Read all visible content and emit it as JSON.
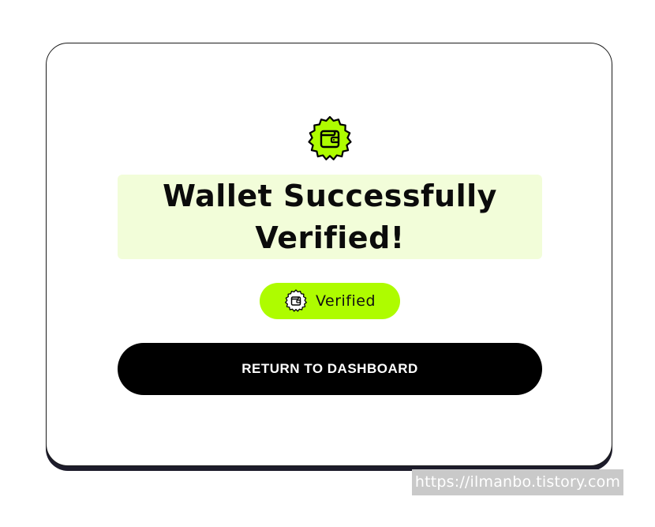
{
  "card": {
    "title": "Wallet Successfully Verified!",
    "status_label": "Verified",
    "cta_label": "RETURN TO DASHBOARD",
    "icon": "wallet-icon"
  },
  "watermark": {
    "text": "https://ilmanbo.tistory.com"
  },
  "colors": {
    "accent": "#aefc00",
    "title_highlight": "#f2fdd9",
    "button_bg": "#000000",
    "button_text": "#ffffff",
    "card_shadow": "#1d1c2b"
  }
}
